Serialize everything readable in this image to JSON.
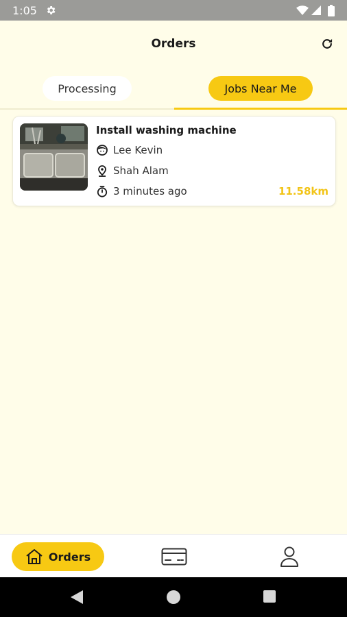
{
  "status_bar": {
    "time": "1:05"
  },
  "header": {
    "title": "Orders"
  },
  "tabs": [
    {
      "label": "Processing",
      "active": false
    },
    {
      "label": "Jobs Near Me",
      "active": true
    }
  ],
  "orders": [
    {
      "title": "Install washing machine",
      "customer": "Lee Kevin",
      "location": "Shah Alam",
      "time_ago": "3 minutes ago",
      "distance": "11.58km"
    }
  ],
  "bottom_nav": {
    "orders_label": "Orders",
    "items": [
      "home-icon",
      "card-icon",
      "user-icon"
    ]
  },
  "colors": {
    "accent": "#f7c913",
    "background": "#fffde9",
    "distance": "#f2c417"
  }
}
